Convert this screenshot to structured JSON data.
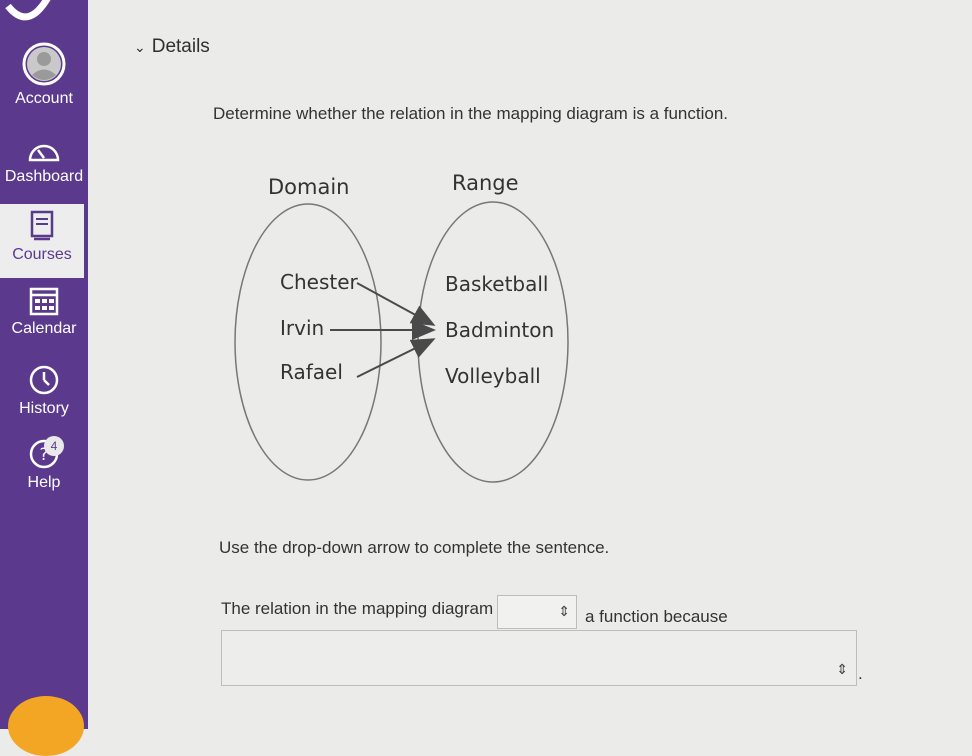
{
  "sidebar": {
    "items": [
      {
        "label": "Account",
        "icon": "user-avatar-icon"
      },
      {
        "label": "Dashboard",
        "icon": "speedometer-icon"
      },
      {
        "label": "Courses",
        "icon": "book-icon"
      },
      {
        "label": "Calendar",
        "icon": "calendar-icon"
      },
      {
        "label": "History",
        "icon": "clock-icon"
      },
      {
        "label": "Help",
        "icon": "help-icon",
        "badge": "4"
      }
    ],
    "colors": {
      "background": "#5b3a8e",
      "active": "#ededed",
      "accent": "#f2a623"
    }
  },
  "details": {
    "label": "Details"
  },
  "question": {
    "text": "Determine whether the relation in the mapping diagram is a function."
  },
  "diagram": {
    "domain_label": "Domain",
    "range_label": "Range",
    "domain": [
      "Chester",
      "Irvin",
      "Rafael"
    ],
    "range": [
      "Basketball",
      "Badminton",
      "Volleyball"
    ],
    "mappings": [
      {
        "from": "Chester",
        "to": "Badminton"
      },
      {
        "from": "Irvin",
        "to": "Badminton"
      },
      {
        "from": "Rafael",
        "to": "Badminton"
      }
    ]
  },
  "instruction": {
    "text": "Use the drop-down arrow to complete the sentence."
  },
  "sentence": {
    "start": "The relation in the mapping diagram",
    "end": "a function because",
    "dropdown1_value": "",
    "dropdown2_value": "",
    "period": "."
  }
}
